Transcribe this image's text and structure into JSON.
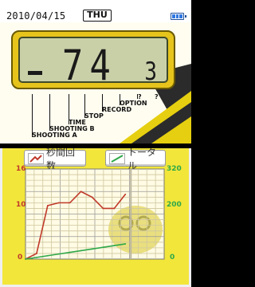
{
  "status": {
    "date": "2010/04/15",
    "day": "THU",
    "battery_icon": "battery-icon"
  },
  "display": {
    "digits": "74",
    "small_digit": "3",
    "cursor": "_"
  },
  "menu": {
    "items": [
      "SHOOTING A",
      "SHOOTING B",
      "TIME",
      "STOP",
      "RECORD",
      "OPTION",
      "?",
      "?"
    ]
  },
  "legend": {
    "left_label": "秒間回数",
    "right_label": "トータル",
    "left_color": "#c0392b",
    "right_color": "#2ea84a"
  },
  "chart_data": {
    "type": "line",
    "left_axis": {
      "ticks": [
        "16",
        "10",
        "0"
      ],
      "ylim": [
        0,
        16
      ]
    },
    "right_axis": {
      "ticks": [
        "320",
        "200",
        "0"
      ],
      "ylim": [
        0,
        320
      ]
    },
    "series": [
      {
        "name": "秒間回数",
        "axis": "left",
        "color": "#c0392b",
        "values": [
          0,
          1,
          9.5,
          10,
          10,
          12,
          11,
          9,
          9,
          11.5
        ]
      },
      {
        "name": "トータル",
        "axis": "right",
        "color": "#2ea84a",
        "values": [
          0,
          6,
          12,
          18,
          24,
          30,
          36,
          42,
          48,
          54
        ]
      }
    ]
  }
}
